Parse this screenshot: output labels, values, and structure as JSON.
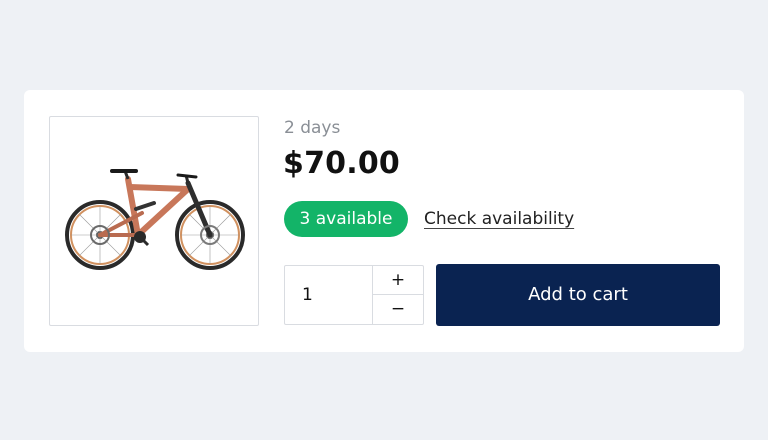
{
  "product": {
    "image_icon": "bicycle-image",
    "duration": "2 days",
    "price": "$70.00",
    "availability_badge": "3 available",
    "check_availability_label": "Check availability"
  },
  "quantity": {
    "value": "1",
    "increment_label": "+",
    "decrement_label": "−"
  },
  "actions": {
    "add_to_cart_label": "Add to cart"
  },
  "colors": {
    "page_background": "#eef1f5",
    "card_background": "#ffffff",
    "badge_green": "#13b468",
    "button_navy": "#0a2351",
    "bike_frame": "#c8775a"
  }
}
